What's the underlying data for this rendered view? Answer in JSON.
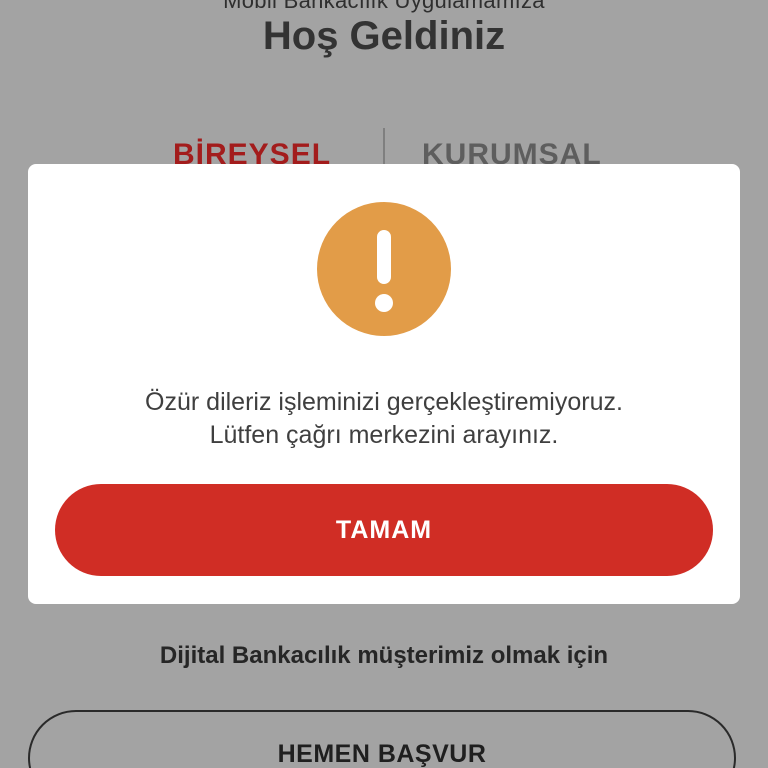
{
  "header": {
    "subtitle": "Mobil Bankacılık Uygulamamıza",
    "title": "Hoş Geldiniz"
  },
  "segments": {
    "individual": "BİREYSEL",
    "corporate": "KURUMSAL"
  },
  "dialog": {
    "icon": "exclamation-icon",
    "message_line1": "Özür dileriz işleminizi gerçekleştiremiyoruz.",
    "message_line2": "Lütfen çağrı merkezini arayınız.",
    "ok_label": "TAMAM"
  },
  "footer": {
    "digital_text": "Dijital Bankacılık müşterimiz olmak için",
    "apply_label": "HEMEN BAŞVUR"
  },
  "colors": {
    "overlay": "#a3a3a3",
    "warning": "#e29c48",
    "primary_red": "#d02d25",
    "active_segment": "#a31c1c"
  }
}
